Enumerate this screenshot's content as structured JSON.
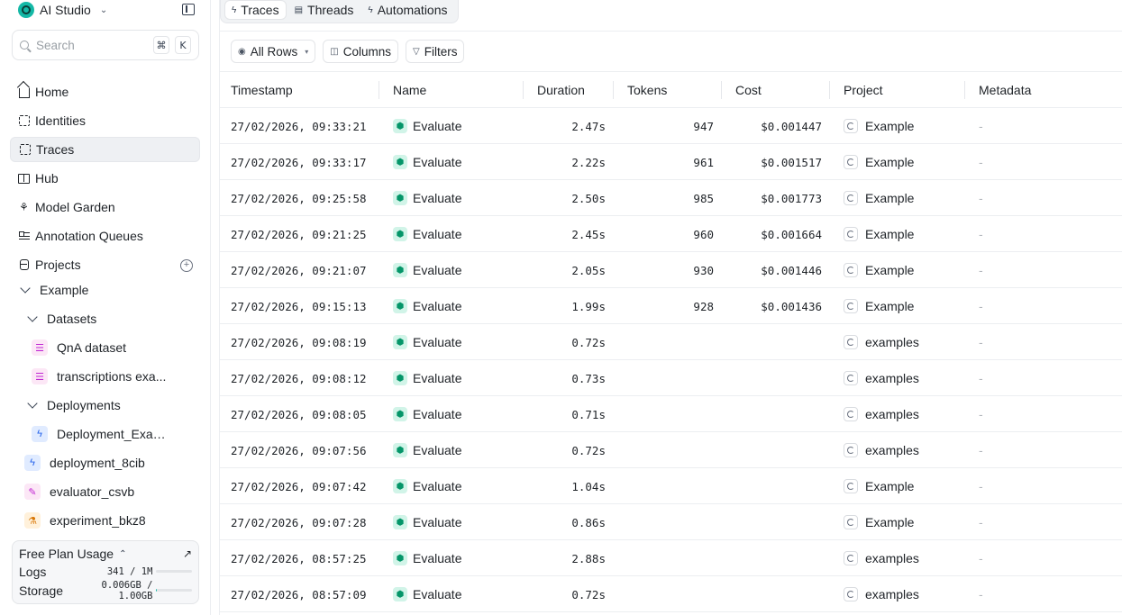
{
  "app": {
    "name": "AI Studio"
  },
  "search": {
    "placeholder": "Search",
    "shortcut_keys": [
      "⌘",
      "K"
    ]
  },
  "sidebar": {
    "nav": [
      {
        "label": "Home",
        "icon": "home-icon"
      },
      {
        "label": "Identities",
        "icon": "identities-icon"
      },
      {
        "label": "Traces",
        "icon": "traces-icon",
        "active": true
      },
      {
        "label": "Hub",
        "icon": "book-icon"
      },
      {
        "label": "Model Garden",
        "icon": "sprout-icon"
      },
      {
        "label": "Annotation Queues",
        "icon": "list-icon"
      },
      {
        "label": "Projects",
        "icon": "stack-icon"
      }
    ],
    "tree": {
      "project": "Example",
      "datasets_label": "Datasets",
      "datasets": [
        "QnA dataset",
        "transcriptions exa..."
      ],
      "deployments_label": "Deployments",
      "deployments": [
        "Deployment_Exam..."
      ],
      "items": [
        {
          "label": "deployment_8cib",
          "icon": "bolt-icon"
        },
        {
          "label": "evaluator_csvb",
          "icon": "evaluator-icon"
        },
        {
          "label": "experiment_bkz8",
          "icon": "experiment-icon"
        }
      ]
    },
    "usage": {
      "title": "Free Plan Usage",
      "logs_label": "Logs",
      "logs_value": "341 / 1M",
      "logs_fraction": 0.0003,
      "storage_label": "Storage",
      "storage_value": "0.006GB / 1.00GB",
      "storage_fraction": 0.006
    }
  },
  "tabs": [
    {
      "label": "Traces",
      "active": true
    },
    {
      "label": "Threads",
      "active": false
    },
    {
      "label": "Automations",
      "active": false
    }
  ],
  "toolbar": {
    "rows_label": "All Rows",
    "columns_label": "Columns",
    "filters_label": "Filters"
  },
  "table": {
    "columns": [
      "Timestamp",
      "Name",
      "Duration",
      "Tokens",
      "Cost",
      "Project",
      "Metadata"
    ],
    "rows": [
      {
        "timestamp": "27/02/2026, 09:33:21",
        "name": "Evaluate",
        "duration": "2.47s",
        "tokens": "947",
        "cost": "$0.001447",
        "project": "Example",
        "metadata": "-"
      },
      {
        "timestamp": "27/02/2026, 09:33:17",
        "name": "Evaluate",
        "duration": "2.22s",
        "tokens": "961",
        "cost": "$0.001517",
        "project": "Example",
        "metadata": "-"
      },
      {
        "timestamp": "27/02/2026, 09:25:58",
        "name": "Evaluate",
        "duration": "2.50s",
        "tokens": "985",
        "cost": "$0.001773",
        "project": "Example",
        "metadata": "-"
      },
      {
        "timestamp": "27/02/2026, 09:21:25",
        "name": "Evaluate",
        "duration": "2.45s",
        "tokens": "960",
        "cost": "$0.001664",
        "project": "Example",
        "metadata": "-"
      },
      {
        "timestamp": "27/02/2026, 09:21:07",
        "name": "Evaluate",
        "duration": "2.05s",
        "tokens": "930",
        "cost": "$0.001446",
        "project": "Example",
        "metadata": "-"
      },
      {
        "timestamp": "27/02/2026, 09:15:13",
        "name": "Evaluate",
        "duration": "1.99s",
        "tokens": "928",
        "cost": "$0.001436",
        "project": "Example",
        "metadata": "-"
      },
      {
        "timestamp": "27/02/2026, 09:08:19",
        "name": "Evaluate",
        "duration": "0.72s",
        "tokens": "",
        "cost": "",
        "project": "examples",
        "metadata": "-"
      },
      {
        "timestamp": "27/02/2026, 09:08:12",
        "name": "Evaluate",
        "duration": "0.73s",
        "tokens": "",
        "cost": "",
        "project": "examples",
        "metadata": "-"
      },
      {
        "timestamp": "27/02/2026, 09:08:05",
        "name": "Evaluate",
        "duration": "0.71s",
        "tokens": "",
        "cost": "",
        "project": "examples",
        "metadata": "-"
      },
      {
        "timestamp": "27/02/2026, 09:07:56",
        "name": "Evaluate",
        "duration": "0.72s",
        "tokens": "",
        "cost": "",
        "project": "examples",
        "metadata": "-"
      },
      {
        "timestamp": "27/02/2026, 09:07:42",
        "name": "Evaluate",
        "duration": "1.04s",
        "tokens": "",
        "cost": "",
        "project": "Example",
        "metadata": "-"
      },
      {
        "timestamp": "27/02/2026, 09:07:28",
        "name": "Evaluate",
        "duration": "0.86s",
        "tokens": "",
        "cost": "",
        "project": "Example",
        "metadata": "-"
      },
      {
        "timestamp": "27/02/2026, 08:57:25",
        "name": "Evaluate",
        "duration": "2.88s",
        "tokens": "",
        "cost": "",
        "project": "examples",
        "metadata": "-"
      },
      {
        "timestamp": "27/02/2026, 08:57:09",
        "name": "Evaluate",
        "duration": "0.72s",
        "tokens": "",
        "cost": "",
        "project": "examples",
        "metadata": "-"
      }
    ]
  },
  "colors": {
    "accent": "#14b8a6",
    "active_bg": "#eef0f3",
    "eval_icon": "#059669"
  }
}
